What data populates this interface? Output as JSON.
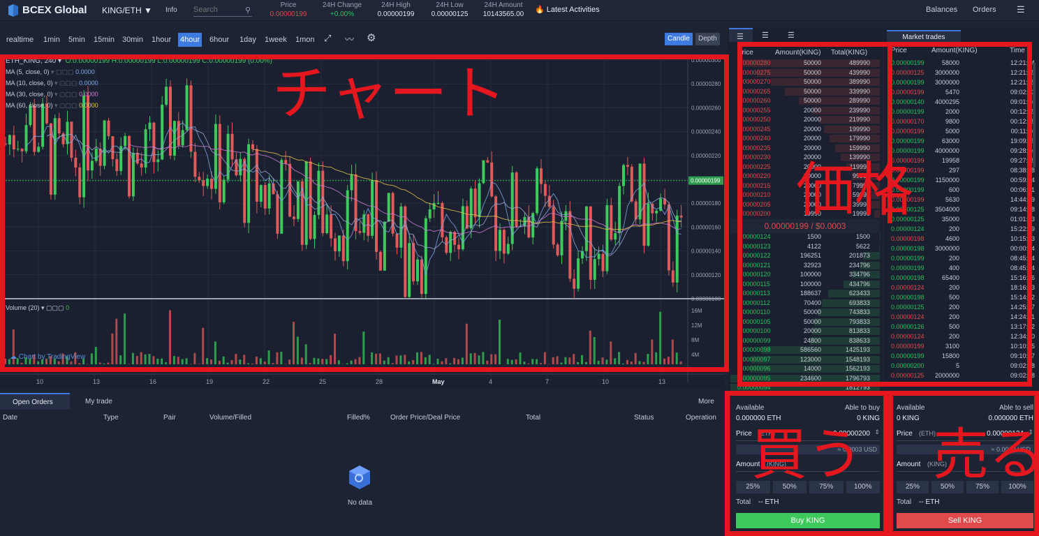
{
  "header": {
    "brand": "BCEX Global",
    "pair": "KING/ETH",
    "info": "Info",
    "search_placeholder": "Search",
    "stats": [
      {
        "label": "Price",
        "value": "0.00000199"
      },
      {
        "label": "24H Change",
        "value": "+0.00%"
      },
      {
        "label": "24H High",
        "value": "0.00000199"
      },
      {
        "label": "24H Low",
        "value": "0.00000125"
      },
      {
        "label": "24H Amount",
        "value": "10143565.00"
      }
    ],
    "latest": "Latest Activities",
    "balances": "Balances",
    "orders": "Orders"
  },
  "toolbar": {
    "intervals": [
      "realtime",
      "1min",
      "5min",
      "15min",
      "30min",
      "1hour",
      "4hour",
      "6hour",
      "1day",
      "1week",
      "1mon"
    ],
    "selected": "4hour",
    "candle": "Candle",
    "depth": "Depth"
  },
  "chart": {
    "symbol": "ETH_KING, 240",
    "ohlc": "O:0.00000199  H:0.00000199  L:0.00000199  C:0.00000199 (0.00%)",
    "indicators": [
      {
        "label": "MA (5, close, 0)",
        "value": "0.0000",
        "color": "#7ea7e6"
      },
      {
        "label": "MA (10, close, 0)",
        "value": "0.0000",
        "color": "#7ea7e6"
      },
      {
        "label": "MA (30, close, 0)",
        "value": "0.0000",
        "color": "#d17ad6"
      },
      {
        "label": "MA (60, close, 0)",
        "value": "0.0000",
        "color": "#e6c24a"
      }
    ],
    "price_ticks": [
      "0.00000300",
      "0.00000280",
      "0.00000260",
      "0.00000240",
      "0.00000220",
      "0.00000180",
      "0.00000160",
      "0.00000140",
      "0.00000120",
      "0.00000100"
    ],
    "last_price_tag": "0.00000199",
    "volume_label": "Volume (20)",
    "volume_value": "0",
    "volume_ticks": [
      "16M",
      "12M",
      "8M",
      "4M"
    ],
    "date_ticks": [
      "10",
      "13",
      "16",
      "19",
      "22",
      "25",
      "28",
      "May",
      "4",
      "7",
      "10",
      "13"
    ],
    "watermark": "Chart by TradingView"
  },
  "chart_data": {
    "type": "candlestick",
    "title": "ETH_KING, 240",
    "ylim": [
      1e-06,
      3e-06
    ],
    "y_ticks": [
      3e-06,
      2.8e-06,
      2.6e-06,
      2.4e-06,
      2.2e-06,
      1.8e-06,
      1.6e-06,
      1.4e-06,
      1.2e-06,
      1e-06
    ],
    "last_price": 1.99e-06,
    "closes": [
      2.3e-06,
      2.4e-06,
      2.3e-06,
      2.1e-06,
      2.4e-06,
      2.5e-06,
      2.4e-06,
      2.3e-06,
      2.5e-06,
      2.4e-06,
      2.3e-06,
      2.4e-06,
      2.5e-06,
      2.4e-06,
      2.3e-06,
      2.4e-06,
      2.5e-06,
      2.4e-06,
      2.3e-06,
      2.4e-06,
      2.3e-06,
      2.4e-06,
      2.5e-06,
      2.4e-06,
      2.3e-06,
      2.4e-06,
      2.5e-06,
      2.4e-06,
      2.3e-06,
      2.4e-06,
      2.5e-06,
      2.4e-06,
      2.3e-06,
      2.4e-06,
      2.5e-06,
      2.4e-06,
      2.3e-06,
      2.4e-06,
      2.5e-06,
      2.4e-06,
      2.3e-06,
      2.4e-06,
      2.5e-06,
      2.4e-06,
      2.3e-06,
      2.4e-06,
      2.5e-06,
      2.4e-06,
      2.3e-06,
      2.4e-06,
      2.5e-06,
      2.4e-06,
      2.3e-06,
      2.4e-06,
      2.5e-06,
      2.4e-06,
      2.3e-06,
      2.4e-06,
      2.5e-06,
      2.4e-06,
      2.3e-06,
      2.4e-06,
      2.5e-06,
      2.4e-06,
      2.3e-06,
      2.4e-06,
      2.5e-06,
      2.4e-06,
      2.3e-06,
      2.4e-06,
      2.5e-06,
      2.4e-06,
      2.3e-06,
      2.4e-06,
      2.5e-06,
      2.4e-06,
      2.3e-06,
      2.4e-06,
      2.5e-06,
      2.4e-06,
      2.3e-06,
      2.4e-06,
      2.5e-06,
      2.4e-06,
      2.3e-06,
      2.4e-06,
      2.5e-06,
      2.4e-06,
      2.3e-06,
      2.4e-06,
      2.5e-06,
      2.4e-06,
      2.3e-06,
      2.4e-06,
      2.5e-06,
      2.4e-06,
      2.3e-06,
      2.4e-06,
      2.5e-06,
      2.4e-06,
      2.3e-06,
      2.4e-06,
      2.5e-06,
      2.4e-06,
      2.3e-06,
      2.4e-06,
      2.5e-06,
      2.4e-06,
      2.3e-06,
      2.4e-06,
      2.5e-06,
      2.4e-06,
      2.3e-06,
      2.4e-06,
      2.5e-06,
      2.4e-06,
      2.3e-06,
      2.4e-06,
      2.5e-06,
      2.4e-06,
      2.3e-06,
      2.4e-06,
      2.5e-06,
      2.4e-06,
      2.3e-06,
      2.4e-06,
      2.5e-06,
      2.4e-06,
      2.3e-06,
      2.4e-06,
      2.5e-06,
      2.4e-06,
      2.3e-06,
      2.4e-06,
      2.5e-06,
      2.4e-06,
      2.3e-06,
      2.4e-06,
      2.5e-06,
      2.4e-06,
      2.3e-06,
      2.4e-06,
      2.5e-06,
      2.4e-06,
      2.3e-06,
      2.4e-06,
      2.5e-06,
      2.4e-06,
      2.3e-06,
      2.4e-06,
      2.5e-06,
      2.4e-06,
      2.3e-06,
      2.4e-06,
      2.5e-06,
      2.4e-06,
      2.3e-06,
      2.4e-06,
      2.5e-06,
      2.4e-06,
      2.3e-06,
      2.4e-06,
      2.5e-06,
      2.4e-06,
      2.3e-06,
      2.4e-06
    ]
  },
  "orderbook": {
    "headers": [
      "Price",
      "Amount(KING)",
      "Total(KING)"
    ],
    "asks": [
      [
        "0.00000280",
        "50000",
        "489990"
      ],
      [
        "0.00000275",
        "50000",
        "439990"
      ],
      [
        "0.00000270",
        "50000",
        "389990"
      ],
      [
        "0.00000265",
        "50000",
        "339990"
      ],
      [
        "0.00000260",
        "50000",
        "289990"
      ],
      [
        "0.00000255",
        "20000",
        "239990"
      ],
      [
        "0.00000250",
        "20000",
        "219990"
      ],
      [
        "0.00000245",
        "20000",
        "199990"
      ],
      [
        "0.00000240",
        "20000",
        "179990"
      ],
      [
        "0.00000235",
        "20000",
        "159990"
      ],
      [
        "0.00000230",
        "20000",
        "139990"
      ],
      [
        "0.00000225",
        "20000",
        "119990"
      ],
      [
        "0.00000220",
        "20000",
        "99990"
      ],
      [
        "0.00000215",
        "20000",
        "79990"
      ],
      [
        "0.00000210",
        "20000",
        "59990"
      ],
      [
        "0.00000205",
        "20000",
        "39990"
      ],
      [
        "0.00000200",
        "19990",
        "19990"
      ]
    ],
    "mid": "0.00000199 / $0.0003",
    "bids": [
      [
        "0.00000124",
        "1500",
        "1500"
      ],
      [
        "0.00000123",
        "4122",
        "5622"
      ],
      [
        "0.00000122",
        "196251",
        "201873"
      ],
      [
        "0.00000121",
        "32923",
        "234796"
      ],
      [
        "0.00000120",
        "100000",
        "334796"
      ],
      [
        "0.00000115",
        "100000",
        "434796"
      ],
      [
        "0.00000113",
        "188637",
        "623433"
      ],
      [
        "0.00000112",
        "70400",
        "693833"
      ],
      [
        "0.00000110",
        "50000",
        "743833"
      ],
      [
        "0.00000105",
        "50000",
        "793833"
      ],
      [
        "0.00000100",
        "20000",
        "813833"
      ],
      [
        "0.00000099",
        "24800",
        "838633"
      ],
      [
        "0.00000098",
        "586560",
        "1425193"
      ],
      [
        "0.00000097",
        "123000",
        "1548193"
      ],
      [
        "0.00000096",
        "14000",
        "1562193"
      ],
      [
        "0.00000095",
        "234600",
        "1796793"
      ],
      [
        "0.00000094",
        "",
        "1812793"
      ]
    ]
  },
  "market_trades": {
    "title": "Market trades",
    "headers": [
      "Price",
      "Amount(KING)",
      "Time"
    ],
    "rows": [
      [
        "0.00000199",
        "58000",
        "12:21:54",
        "g"
      ],
      [
        "0.00000125",
        "3000000",
        "12:21:25",
        "r"
      ],
      [
        "0.00000199",
        "3000000",
        "12:21:25",
        "g"
      ],
      [
        "0.00000199",
        "5470",
        "09:02:03",
        "r"
      ],
      [
        "0.00000140",
        "4000295",
        "09:01:44",
        "g"
      ],
      [
        "0.00000199",
        "2000",
        "00:12:45",
        "g"
      ],
      [
        "0.00000170",
        "9800",
        "00:12:28",
        "r"
      ],
      [
        "0.00000199",
        "5000",
        "00:11:54",
        "r"
      ],
      [
        "0.00000199",
        "63000",
        "19:09:59",
        "g"
      ],
      [
        "0.00000199",
        "4000000",
        "09:28:04",
        "g"
      ],
      [
        "0.00000199",
        "19958",
        "09:27:48",
        "r"
      ],
      [
        "0.00000199",
        "297",
        "08:38:18",
        "r"
      ],
      [
        "0.00000199",
        "1150000",
        "00:59:04",
        "g"
      ],
      [
        "0.00000199",
        "600",
        "00:06:31",
        "g"
      ],
      [
        "0.00000199",
        "5630",
        "14:44:29",
        "r"
      ],
      [
        "0.00000125",
        "3504000",
        "09:14:08",
        "g"
      ],
      [
        "0.00000125",
        "35000",
        "01:01:43",
        "g"
      ],
      [
        "0.00000124",
        "200",
        "15:22:39",
        "g"
      ],
      [
        "0.00000198",
        "4600",
        "10:15:53",
        "r"
      ],
      [
        "0.00000198",
        "3000000",
        "00:00:34",
        "g"
      ],
      [
        "0.00000199",
        "200",
        "08:45:24",
        "g"
      ],
      [
        "0.00000199",
        "400",
        "08:45:24",
        "g"
      ],
      [
        "0.00000198",
        "65400",
        "15:16:26",
        "g"
      ],
      [
        "0.00000124",
        "200",
        "18:16:53",
        "r"
      ],
      [
        "0.00000198",
        "500",
        "15:14:02",
        "g"
      ],
      [
        "0.00000125",
        "200",
        "14:25:57",
        "g"
      ],
      [
        "0.00000124",
        "200",
        "14:24:41",
        "r"
      ],
      [
        "0.00000126",
        "500",
        "13:17:52",
        "g"
      ],
      [
        "0.00000124",
        "200",
        "12:34:40",
        "r"
      ],
      [
        "0.00000199",
        "3100",
        "10:10:25",
        "r"
      ],
      [
        "0.00000199",
        "15800",
        "09:10:37",
        "g"
      ],
      [
        "0.00000200",
        "5",
        "09:02:48",
        "g"
      ],
      [
        "0.00000125",
        "2000000",
        "09:02:28",
        "r"
      ]
    ]
  },
  "orders_panel": {
    "tabs": [
      "Open Orders",
      "My trade"
    ],
    "more": "More",
    "columns": [
      "Date",
      "Type",
      "Pair",
      "Volume/Filled",
      "Filled%",
      "Order Price/Deal Price",
      "Total",
      "Status",
      "Operation"
    ],
    "empty": "No data"
  },
  "buy": {
    "available_label": "Available",
    "able_label": "Able to buy",
    "available": "0.000000 ETH",
    "able": "0 KING",
    "price_label": "Price",
    "price_unit": "(ETH)",
    "price": "0.00000200",
    "usd": "≈ 0.0003 USD",
    "amount_label": "Amount",
    "amount_unit": "(KING)",
    "pcts": [
      "25%",
      "50%",
      "75%",
      "100%"
    ],
    "total_label": "Total",
    "total": "-- ETH",
    "button": "Buy KING",
    "color": "#3ec95c"
  },
  "sell": {
    "available_label": "Available",
    "able_label": "Able to sell",
    "available": "0 KING",
    "able": "0.000000 ETH",
    "price_label": "Price",
    "price_unit": "(ETH)",
    "price": "0.00000124",
    "usd": "≈ 0.0002 USD",
    "amount_label": "Amount",
    "amount_unit": "(KING)",
    "pcts": [
      "25%",
      "50%",
      "75%",
      "100%"
    ],
    "total_label": "Total",
    "total": "-- ETH",
    "button": "Sell KING",
    "color": "#e04a4a"
  },
  "annotations": {
    "chart": "チャート",
    "price": "価格",
    "buy": "買う",
    "sell": "売る"
  }
}
